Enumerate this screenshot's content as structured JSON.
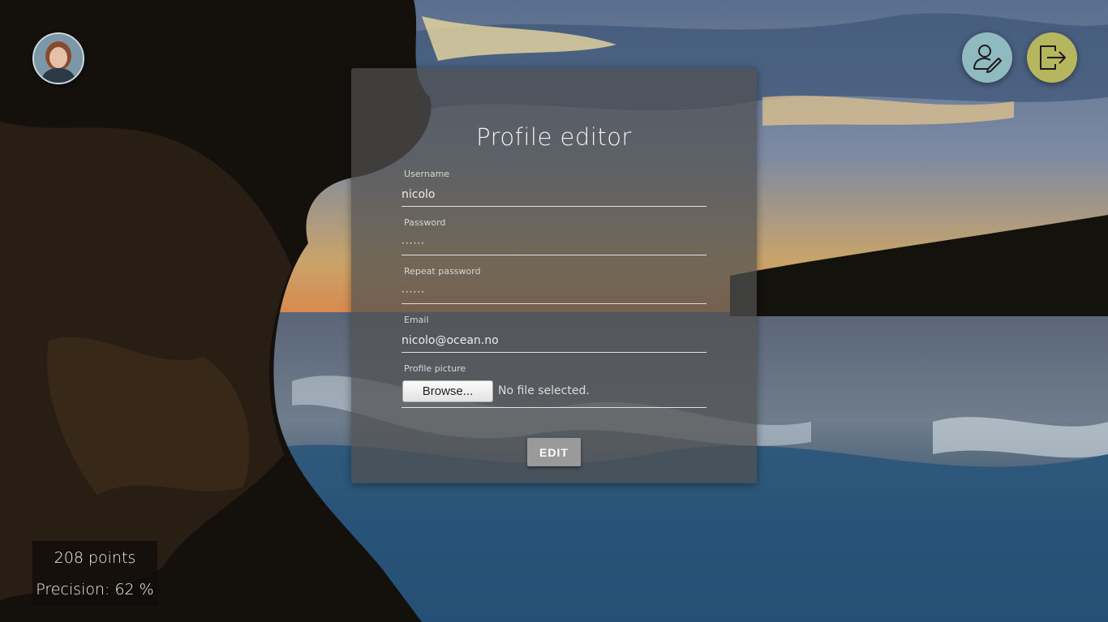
{
  "header": {
    "avatar_label": "user avatar",
    "profile_icon": "user-edit-icon",
    "logout_icon": "logout-icon"
  },
  "form": {
    "title": "Profile editor",
    "username": {
      "label": "Username",
      "value": "nicolo"
    },
    "password": {
      "label": "Password",
      "value": "······"
    },
    "repeat_password": {
      "label": "Repeat password",
      "value": "······"
    },
    "email": {
      "label": "Email",
      "value": "nicolo@ocean.no"
    },
    "picture": {
      "label": "Profile picture",
      "browse_label": "Browse...",
      "status": "No file selected."
    },
    "submit_label": "EDIT"
  },
  "stats": {
    "points": "208 points",
    "precision": "Precision: 62 %"
  },
  "colors": {
    "profile_button": "#8fbac0",
    "logout_button": "#b5b65e",
    "panel": "#505050"
  }
}
